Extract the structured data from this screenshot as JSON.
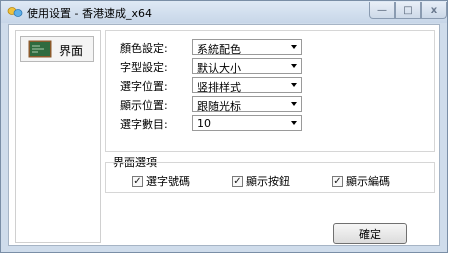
{
  "window": {
    "title": "使用设置 - 香港速成_x64",
    "minimize_glyph": "—",
    "maximize_glyph": "□",
    "close_glyph": "x"
  },
  "nav": {
    "items": [
      {
        "label": "界面",
        "icon": "chalkboard-icon"
      }
    ]
  },
  "settings": {
    "rows": [
      {
        "label": "顏色設定:",
        "value": "系統配色"
      },
      {
        "label": "字型設定:",
        "value": "默认大小"
      },
      {
        "label": "選字位置:",
        "value": "竖排样式"
      },
      {
        "label": "顯示位置:",
        "value": "跟随光标"
      },
      {
        "label": "選字數目:",
        "value": "10"
      }
    ]
  },
  "options": {
    "title": "界面選項",
    "checks": [
      {
        "label": "選字號碼",
        "checked": true
      },
      {
        "label": "顯示按鈕",
        "checked": true
      },
      {
        "label": "顯示編碼",
        "checked": true
      }
    ]
  },
  "footer": {
    "ok_label": "確定"
  },
  "colors": {
    "frame": "#cfdceb",
    "chalkboard": "#2f6b3f",
    "chalkboard_frame": "#8b5a2b"
  }
}
